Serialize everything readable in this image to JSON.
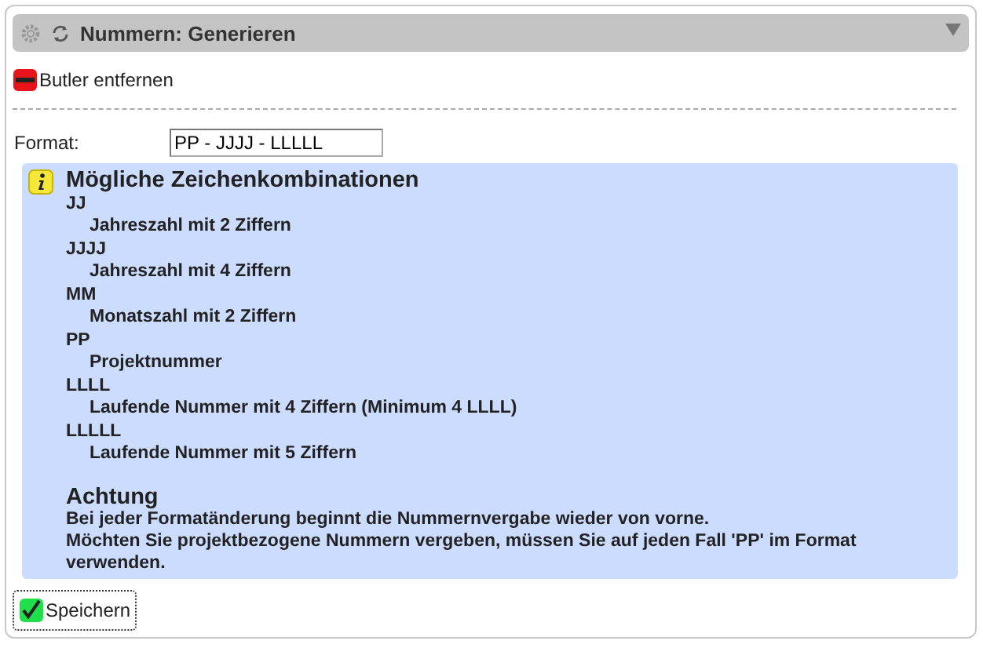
{
  "panel": {
    "title": "Nummern: Generieren",
    "collapsed": false
  },
  "remove_button": {
    "label": "Butler entfernen"
  },
  "format": {
    "label": "Format:",
    "value": "PP - JJJJ - LLLLL"
  },
  "info": {
    "title": "Mögliche Zeichenkombinationen",
    "entries": [
      {
        "code": "JJ",
        "description": "Jahreszahl mit 2 Ziffern"
      },
      {
        "code": "JJJJ",
        "description": "Jahreszahl mit 4 Ziffern"
      },
      {
        "code": "MM",
        "description": "Monatszahl mit 2 Ziffern"
      },
      {
        "code": "PP",
        "description": "Projektnummer"
      },
      {
        "code": "LLLL",
        "description": "Laufende Nummer mit 4 Ziffern (Minimum 4 LLLL)"
      },
      {
        "code": "LLLLL",
        "description": "Laufende Nummer mit 5 Ziffern"
      }
    ],
    "warning_title": "Achtung",
    "warning_lines": [
      "Bei jeder Formatänderung beginnt die Nummernvergabe wieder von vorne.",
      "Möchten Sie projektbezogene Nummern vergeben, müssen Sie auf jeden Fall 'PP' im Format verwenden."
    ]
  },
  "save_button": {
    "label": "Speichern"
  }
}
